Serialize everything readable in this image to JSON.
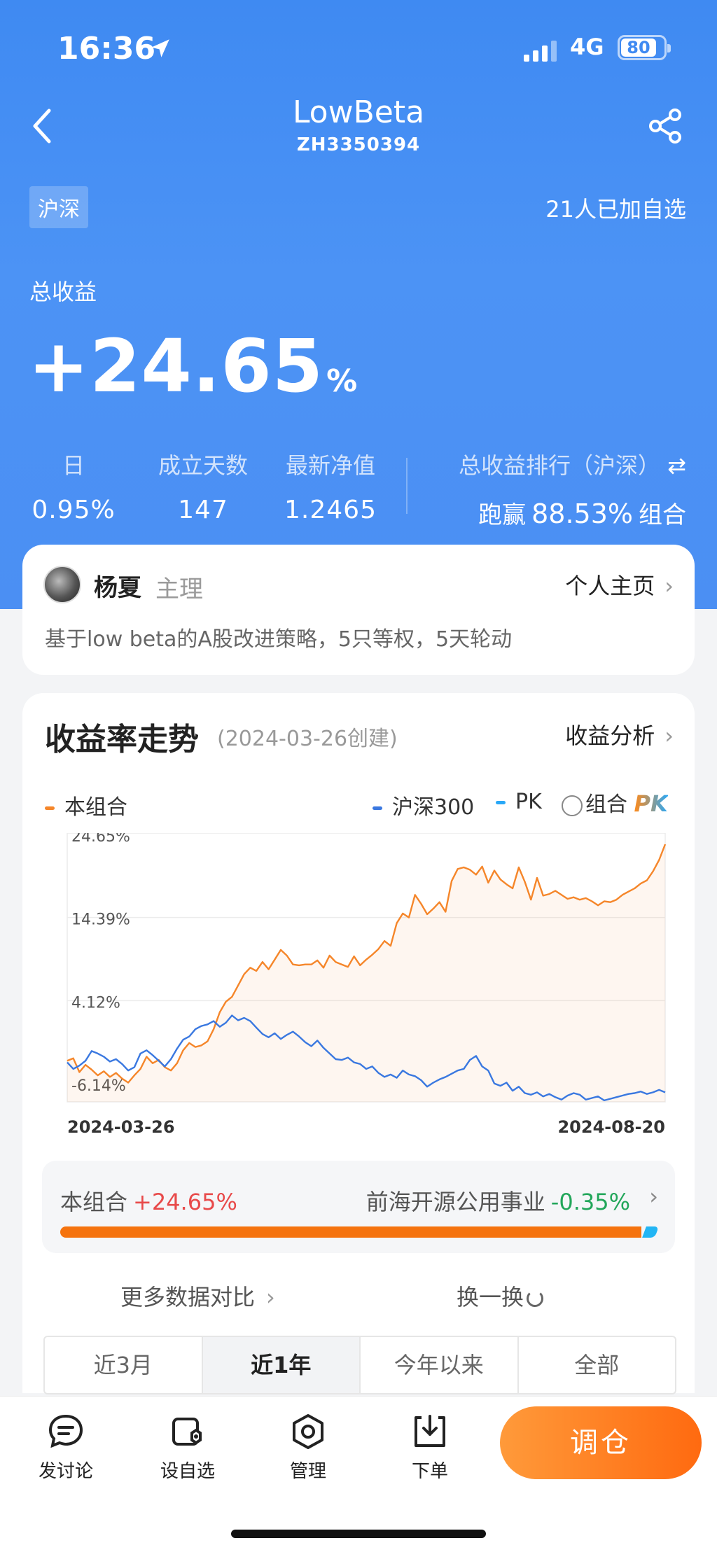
{
  "status": {
    "time": "16:36",
    "network": "4G",
    "battery": "80"
  },
  "nav": {
    "title": "LowBeta",
    "code": "ZH3350394"
  },
  "market_tag": "沪深",
  "followers": "21人已加自选",
  "total_return": {
    "label": "总收益",
    "value": "+24.65",
    "unit": "%"
  },
  "stats": [
    {
      "label": "日",
      "value": "0.95%"
    },
    {
      "label": "成立天数",
      "value": "147"
    },
    {
      "label": "最新净值",
      "value": "1.2465"
    }
  ],
  "rank": {
    "label": "总收益排行（沪深）",
    "prefix": "跑赢",
    "value": "88.53%",
    "suffix": "组合"
  },
  "manager": {
    "name": "杨夏",
    "role": "主理",
    "link": "个人主页",
    "description": "基于low beta的A股改进策略，5只等权，5天轮动"
  },
  "performance": {
    "title": "收益率走势",
    "created": "(2024-03-26创建)",
    "analysis_link": "收益分析",
    "legend": {
      "portfolio": "本组合",
      "index": "沪深300",
      "pk": "PK",
      "pk_toggle": "组合",
      "pk_logo": "PK"
    },
    "colors": {
      "portfolio": "#f5862a",
      "index": "#3a78e0",
      "pk": "#29a8f7"
    }
  },
  "chart_data": {
    "type": "line",
    "x_start": "2024-03-26",
    "x_end": "2024-08-20",
    "yticks": [
      "24.65%",
      "14.39%",
      "4.12%",
      "-6.14%"
    ],
    "ylim": [
      -6.14,
      24.65
    ],
    "series": [
      {
        "name": "本组合",
        "values": [
          -2.1,
          -1.8,
          -3.5,
          -2.6,
          -3.2,
          -3.9,
          -3.4,
          -4.1,
          -3.6,
          -4.3,
          -4.8,
          -3.9,
          -3.1,
          -1.6,
          -2.4,
          -2.0,
          -2.9,
          -3.3,
          -2.4,
          -0.8,
          0.1,
          -0.4,
          -0.2,
          0.3,
          1.8,
          3.9,
          5.2,
          5.8,
          7.2,
          8.6,
          9.4,
          9.0,
          10.1,
          9.2,
          10.4,
          11.6,
          10.9,
          9.8,
          9.7,
          9.8,
          9.8,
          10.3,
          9.4,
          10.9,
          10.1,
          9.8,
          9.5,
          10.8,
          9.7,
          10.4,
          11.0,
          11.7,
          12.7,
          12.1,
          14.9,
          16.1,
          15.6,
          18.4,
          17.3,
          16.0,
          16.7,
          17.5,
          16.3,
          20.1,
          21.6,
          21.8,
          21.5,
          20.9,
          21.9,
          19.9,
          21.4,
          20.3,
          19.7,
          19.2,
          21.8,
          20.0,
          17.8,
          20.5,
          18.3,
          18.5,
          18.9,
          18.4,
          17.9,
          18.1,
          17.8,
          18.0,
          17.6,
          17.1,
          17.6,
          17.5,
          17.8,
          18.4,
          18.8,
          19.2,
          19.8,
          20.2,
          21.3,
          22.7,
          24.65
        ]
      },
      {
        "name": "沪深300",
        "values": [
          -2.3,
          -3.1,
          -2.7,
          -2.1,
          -0.9,
          -1.2,
          -1.6,
          -2.2,
          -1.9,
          -2.5,
          -3.3,
          -2.9,
          -1.2,
          -0.8,
          -1.4,
          -2.1,
          -2.8,
          -1.9,
          -0.6,
          0.5,
          0.9,
          1.8,
          2.2,
          2.4,
          2.8,
          2.1,
          2.6,
          3.5,
          2.9,
          3.2,
          2.8,
          2.0,
          1.2,
          0.8,
          1.3,
          0.6,
          1.1,
          1.5,
          0.9,
          0.2,
          -0.3,
          0.4,
          -0.5,
          -1.2,
          -1.9,
          -2.0,
          -1.7,
          -2.3,
          -2.5,
          -3.1,
          -2.8,
          -3.6,
          -4.1,
          -3.8,
          -4.2,
          -3.3,
          -3.8,
          -4.0,
          -4.5,
          -5.3,
          -4.8,
          -4.4,
          -4.1,
          -3.7,
          -3.3,
          -3.1,
          -2.0,
          -1.5,
          -2.8,
          -3.3,
          -4.9,
          -5.2,
          -4.8,
          -5.8,
          -5.3,
          -6.1,
          -6.3,
          -6.0,
          -6.5,
          -6.2,
          -6.6,
          -6.9,
          -6.4,
          -6.1,
          -6.3,
          -6.9,
          -6.7,
          -6.5,
          -7.0,
          -6.8,
          -6.6,
          -6.4,
          -6.2,
          -6.1,
          -5.9,
          -6.2,
          -6.0,
          -5.7,
          -6.0
        ]
      }
    ]
  },
  "pk": {
    "left_label": "本组合",
    "left_value": "+24.65%",
    "right_label": "前海开源公用事业",
    "right_value": "-0.35%",
    "left_share": 0.98
  },
  "actions": {
    "more": "更多数据对比",
    "swap": "换一换"
  },
  "tabs": [
    "近3月",
    "近1年",
    "今年以来",
    "全部"
  ],
  "active_tab": "近1年",
  "bottom_bar": {
    "discuss": "发讨论",
    "watch": "设自选",
    "manage": "管理",
    "order": "下单",
    "trade": "调仓"
  }
}
